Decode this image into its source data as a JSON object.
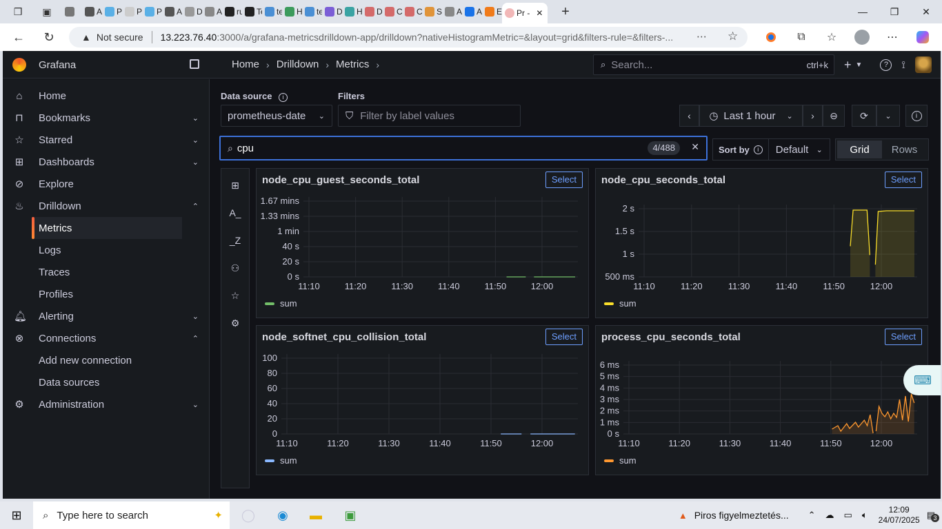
{
  "browser": {
    "tabs": [
      {
        "label": "",
        "color": "#777"
      },
      {
        "label": "A\\",
        "color": "#555"
      },
      {
        "label": "Pl",
        "color": "#5ab0e6"
      },
      {
        "label": "Pr",
        "color": "#ccc"
      },
      {
        "label": "Pl",
        "color": "#5ab0e6"
      },
      {
        "label": "A\\",
        "color": "#555"
      },
      {
        "label": "D",
        "color": "#999"
      },
      {
        "label": "A\\",
        "color": "#888"
      },
      {
        "label": "ru",
        "color": "#222"
      },
      {
        "label": "Te",
        "color": "#222"
      },
      {
        "label": "te",
        "color": "#4a8fd4"
      },
      {
        "label": "H",
        "color": "#3c9b5c"
      },
      {
        "label": "te",
        "color": "#4a8fd4"
      },
      {
        "label": "D",
        "color": "#7b5ed6"
      },
      {
        "label": "H",
        "color": "#3aa3a3"
      },
      {
        "label": "D",
        "color": "#d46a6a"
      },
      {
        "label": "Cl",
        "color": "#d46a6a"
      },
      {
        "label": "Cr",
        "color": "#d46a6a"
      },
      {
        "label": "Se",
        "color": "#e0943a"
      },
      {
        "label": "A:",
        "color": "#888"
      },
      {
        "label": "Am",
        "color": "#1a73e8"
      },
      {
        "label": "EC",
        "color": "#f07b1a"
      }
    ],
    "active_tab_label": "Pr -",
    "url_warning": "Not secure",
    "url_host": "13.223.76.40",
    "url_rest": ":3000/a/grafana-metricsdrilldown-app/drilldown?nativeHistogramMetric=&layout=grid&filters-rule=&filters-..."
  },
  "grafana": {
    "brand": "Grafana",
    "breadcrumb": [
      "Home",
      "Drilldown",
      "Metrics"
    ],
    "search_placeholder": "Search...",
    "search_shortcut": "ctrl+k",
    "nav": [
      {
        "label": "Home",
        "icon": "home-icon",
        "chev": ""
      },
      {
        "label": "Bookmarks",
        "icon": "bookmark-icon",
        "chev": "⌄"
      },
      {
        "label": "Starred",
        "icon": "star-icon",
        "chev": "⌄"
      },
      {
        "label": "Dashboards",
        "icon": "grid-icon",
        "chev": "⌄"
      },
      {
        "label": "Explore",
        "icon": "compass-icon",
        "chev": ""
      },
      {
        "label": "Drilldown",
        "icon": "drilldown-icon",
        "chev": "⌃"
      },
      {
        "label": "Metrics",
        "icon": "",
        "chev": "",
        "current": true
      },
      {
        "label": "Logs",
        "icon": "",
        "chev": ""
      },
      {
        "label": "Traces",
        "icon": "",
        "chev": ""
      },
      {
        "label": "Profiles",
        "icon": "",
        "chev": ""
      },
      {
        "label": "Alerting",
        "icon": "bell-icon",
        "chev": "⌄"
      },
      {
        "label": "Connections",
        "icon": "connections-icon",
        "chev": "⌃"
      },
      {
        "label": "Add new connection",
        "icon": "",
        "chev": ""
      },
      {
        "label": "Data sources",
        "icon": "",
        "chev": ""
      },
      {
        "label": "Administration",
        "icon": "cog-icon",
        "chev": "⌄"
      }
    ],
    "toolbar": {
      "datasource_label": "Data source",
      "datasource_value": "prometheus-date",
      "filters_label": "Filters",
      "filters_placeholder": "Filter by label values",
      "time_range": "Last 1 hour",
      "metric_search_value": "cpu",
      "metric_count": "4/488",
      "sort_label": "Sort by",
      "sort_value": "Default",
      "layout_grid": "Grid",
      "layout_rows": "Rows"
    },
    "panels": [
      {
        "title": "node_cpu_guest_seconds_total",
        "select": "Select",
        "legend": "sum",
        "color": "#73bf69",
        "y_ticks": [
          "1.67 mins",
          "1.33 mins",
          "1 min",
          "40 s",
          "20 s",
          "0 s"
        ],
        "x_ticks": [
          "11:10",
          "11:20",
          "11:30",
          "11:40",
          "11:50",
          "12:00"
        ]
      },
      {
        "title": "node_cpu_seconds_total",
        "select": "Select",
        "legend": "sum",
        "color": "#fade2a",
        "y_ticks": [
          "2 s",
          "1.5 s",
          "1 s",
          "500 ms"
        ],
        "x_ticks": [
          "11:10",
          "11:20",
          "11:30",
          "11:40",
          "11:50",
          "12:00"
        ]
      },
      {
        "title": "node_softnet_cpu_collision_total",
        "select": "Select",
        "legend": "sum",
        "color": "#8ab8ff",
        "y_ticks": [
          "100",
          "80",
          "60",
          "40",
          "20",
          "0"
        ],
        "x_ticks": [
          "11:10",
          "11:20",
          "11:30",
          "11:40",
          "11:50",
          "12:00"
        ]
      },
      {
        "title": "process_cpu_seconds_total",
        "select": "Select",
        "legend": "sum",
        "color": "#ff9830",
        "y_ticks": [
          "6 ms",
          "5 ms",
          "4 ms",
          "3 ms",
          "2 ms",
          "1 ms",
          "0 s"
        ],
        "x_ticks": [
          "11:10",
          "11:20",
          "11:30",
          "11:40",
          "11:50",
          "12:00"
        ]
      }
    ]
  },
  "taskbar": {
    "search_placeholder": "Type here to search",
    "notification": "Piros figyelmeztetés...",
    "time": "12:09",
    "date": "24/07/2025",
    "notif_count": "3"
  }
}
